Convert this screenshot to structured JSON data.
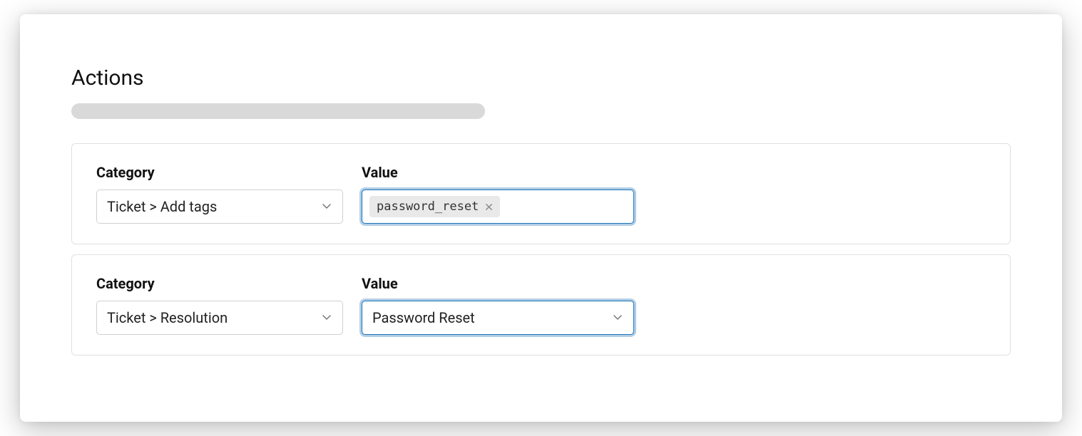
{
  "section": {
    "title": "Actions"
  },
  "labels": {
    "category": "Category",
    "value": "Value"
  },
  "actions": [
    {
      "category": "Ticket > Add tags",
      "value_type": "tags",
      "tags": [
        "password_reset"
      ],
      "focused": true
    },
    {
      "category": "Ticket > Resolution",
      "value_type": "select",
      "value": "Password Reset",
      "focused": true
    }
  ]
}
